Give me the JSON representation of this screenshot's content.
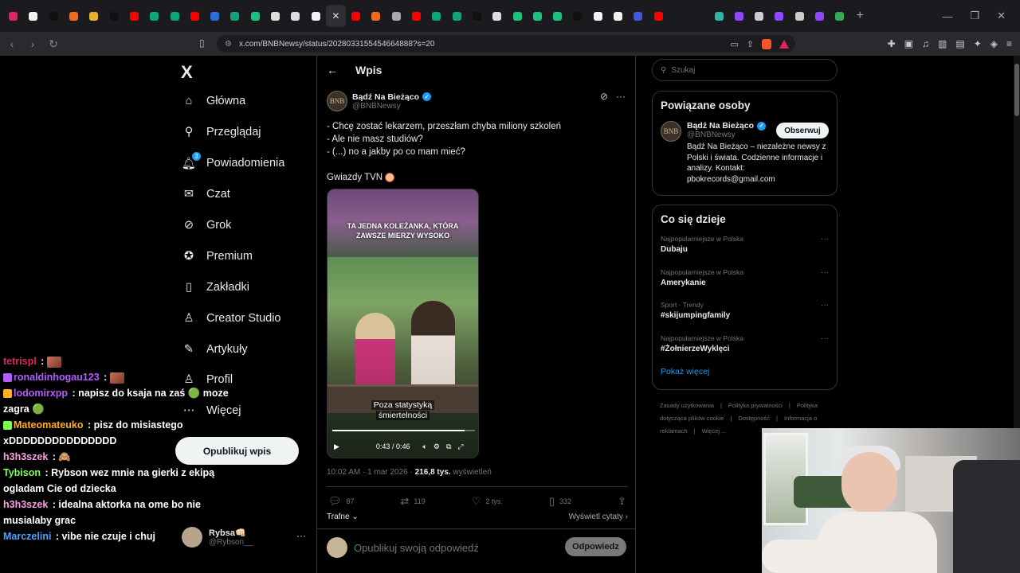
{
  "browser": {
    "tabs": [
      {
        "color": "#e0245e",
        "active": false
      },
      {
        "color": "#f2f2f2",
        "active": false
      },
      {
        "color": "#111111",
        "active": false
      },
      {
        "color": "#f26a1b",
        "active": false
      },
      {
        "color": "#e8b12c",
        "active": false
      },
      {
        "color": "#111111",
        "active": false
      },
      {
        "color": "#ff0000",
        "active": false
      },
      {
        "color": "#10a37f",
        "active": false
      },
      {
        "color": "#10a37f",
        "active": false
      },
      {
        "color": "#ff0000",
        "active": false
      },
      {
        "color": "#2a6fd6",
        "active": false
      },
      {
        "color": "#10a37f",
        "active": false
      },
      {
        "color": "#19c37d",
        "active": false
      },
      {
        "color": "#dddddd",
        "active": false
      },
      {
        "color": "#dddddd",
        "active": false
      },
      {
        "color": "#f2f2f2",
        "active": false
      },
      {
        "color": "#2e2e33",
        "active": true
      },
      {
        "color": "#ff0000",
        "active": false
      },
      {
        "color": "#f26a1b",
        "active": false
      },
      {
        "color": "#aaaaaa",
        "active": false
      },
      {
        "color": "#ff0000",
        "active": false
      },
      {
        "color": "#10a37f",
        "active": false
      },
      {
        "color": "#10a37f",
        "active": false
      },
      {
        "color": "#111111",
        "active": false
      },
      {
        "color": "#dddddd",
        "active": false
      },
      {
        "color": "#19c37d",
        "active": false
      },
      {
        "color": "#19c37d",
        "active": false
      },
      {
        "color": "#19c37d",
        "active": false
      },
      {
        "color": "#111111",
        "active": false
      },
      {
        "color": "#f2f2f2",
        "active": false
      },
      {
        "color": "#f2f2f2",
        "active": false
      },
      {
        "color": "#3b5bdb",
        "active": false
      },
      {
        "color": "#ff0000",
        "active": false
      },
      {
        "color": "#1b1b1f",
        "active": false
      },
      {
        "color": "#1b1b1f",
        "active": false
      },
      {
        "color": "#2fb5a5",
        "active": false
      },
      {
        "color": "#9146ff",
        "active": false
      },
      {
        "color": "#cccccc",
        "active": false
      },
      {
        "color": "#9146ff",
        "active": false
      },
      {
        "color": "#cccccc",
        "active": false
      },
      {
        "color": "#9146ff",
        "active": false
      },
      {
        "color": "#34a853",
        "active": false
      }
    ],
    "url": "x.com/BNBNewsy/status/2028033155454664888?s=20"
  },
  "sidebar": {
    "logo": "X",
    "items": [
      {
        "label": "Główna",
        "icon": "home-icon",
        "glyph": "⌂"
      },
      {
        "label": "Przeglądaj",
        "icon": "search-icon",
        "glyph": "⚲"
      },
      {
        "label": "Powiadomienia",
        "icon": "bell-icon",
        "glyph": "🔔︎",
        "badge": "3"
      },
      {
        "label": "Czat",
        "icon": "mail-icon",
        "glyph": "✉"
      },
      {
        "label": "Grok",
        "icon": "grok-icon",
        "glyph": "⊘"
      },
      {
        "label": "Premium",
        "icon": "premium-icon",
        "glyph": "✪"
      },
      {
        "label": "Zakładki",
        "icon": "bookmark-icon",
        "glyph": "▯"
      },
      {
        "label": "Creator Studio",
        "icon": "creator-studio-icon",
        "glyph": "♙"
      },
      {
        "label": "Artykuły",
        "icon": "articles-icon",
        "glyph": "✎"
      },
      {
        "label": "Profil",
        "icon": "profile-icon",
        "glyph": "♙"
      },
      {
        "label": "Więcej",
        "icon": "more-circle-icon",
        "glyph": "⋯"
      }
    ],
    "post_button": "Opublikuj wpis",
    "account": {
      "name": "Rybsa👊🏻",
      "handle": "@Rybson__"
    }
  },
  "main": {
    "header": "Wpis",
    "author": {
      "name": "Bądź Na Bieżąco",
      "handle": "@BNBNewsy",
      "avatar_text": "BNB"
    },
    "text_lines": [
      "- Chcę zostać lekarzem, przeszłam chyba miliony szkoleń",
      "- Ale nie masz studiów?",
      "- (...) no a jakby po co mam mieć?"
    ],
    "text_tail": "Gwiazdy TVN",
    "video": {
      "top_line1": "TA JEDNA KOLEŻANKA, KTÓRA",
      "top_line2": "ZAWSZE MIERZY WYSOKO",
      "caption_line1": "Poza statystyką",
      "caption_line2": "śmiertelności",
      "time": "0:43 / 0:46",
      "progress": 0.93
    },
    "meta": {
      "time": "10:02 AM · 1 mar 2026 · ",
      "views": "216,8 tys.",
      "views_label": " wyświetleń"
    },
    "actions": {
      "replies": "87",
      "reposts": "119",
      "likes": "2 tys.",
      "bookmarks": "332"
    },
    "sort": {
      "left": "Trafne",
      "right": "Wyświetl cytaty"
    },
    "reply": {
      "placeholder": "Opublikuj swoją odpowiedź",
      "button": "Odpowiedz"
    }
  },
  "right": {
    "search_placeholder": "Szukaj",
    "related": {
      "title": "Powiązane osoby",
      "name": "Bądź Na Bieżąco",
      "handle": "@BNBNewsy",
      "avatar_text": "BNB",
      "bio": "Bądź Na Bieżąco – niezależne newsy z Polski i świata. Codzienne informacje i analizy. Kontakt: pbokrecords@gmail.com",
      "follow": "Obserwuj"
    },
    "trends": {
      "title": "Co się dzieje",
      "items": [
        {
          "context": "Najpopularniejsze w Polska",
          "name": "Dubaju"
        },
        {
          "context": "Najpopularniejsze w Polska",
          "name": "Amerykanie"
        },
        {
          "context": "Sport · Trendy",
          "name": "#skijumpingfamily"
        },
        {
          "context": "Najpopularniejsze w Polska",
          "name": "#ŻołnierzeWyklęci"
        }
      ],
      "show_more": "Pokaż więcej"
    },
    "footer": [
      "Zasady użytkowania",
      "|",
      "Polityka prywatności",
      "|",
      "Polityka dotycząca plików cookie",
      "|",
      "Dostępność",
      "|",
      "Informacja o reklamach",
      "|",
      "Więcej ..."
    ]
  },
  "chat": [
    {
      "user": "tetrispl",
      "color": "#e0245e",
      "text": ":",
      "emote": true
    },
    {
      "user": "ronaldinhogau123",
      "color": "#b35cff",
      "text": ":",
      "emote": true
    },
    {
      "user": "lodomirxpp",
      "color": "#b35cff",
      "text": ": napisz do ksaja na zaś 🟢 moze zagra 🟢"
    },
    {
      "user": "Mateomateuko",
      "color": "#ffb020",
      "text": ": pisz do misiastego xDDDDDDDDDDDDDDD"
    },
    {
      "user": "h3h3szek",
      "color": "#ff9ee5",
      "text": ": 🙈"
    },
    {
      "user": "Tybison",
      "color": "#7cff4f",
      "text": ": Rybson wez mnie na gierki z ekipą ogladam Cie od dziecka"
    },
    {
      "user": "h3h3szek",
      "color": "#ff9ee5",
      "text": ": idealna aktorka na ome bo nie musialaby grac"
    },
    {
      "user": "Marczelini",
      "color": "#4fa3ff",
      "text": ": vibe nie czuje i chuj"
    }
  ]
}
